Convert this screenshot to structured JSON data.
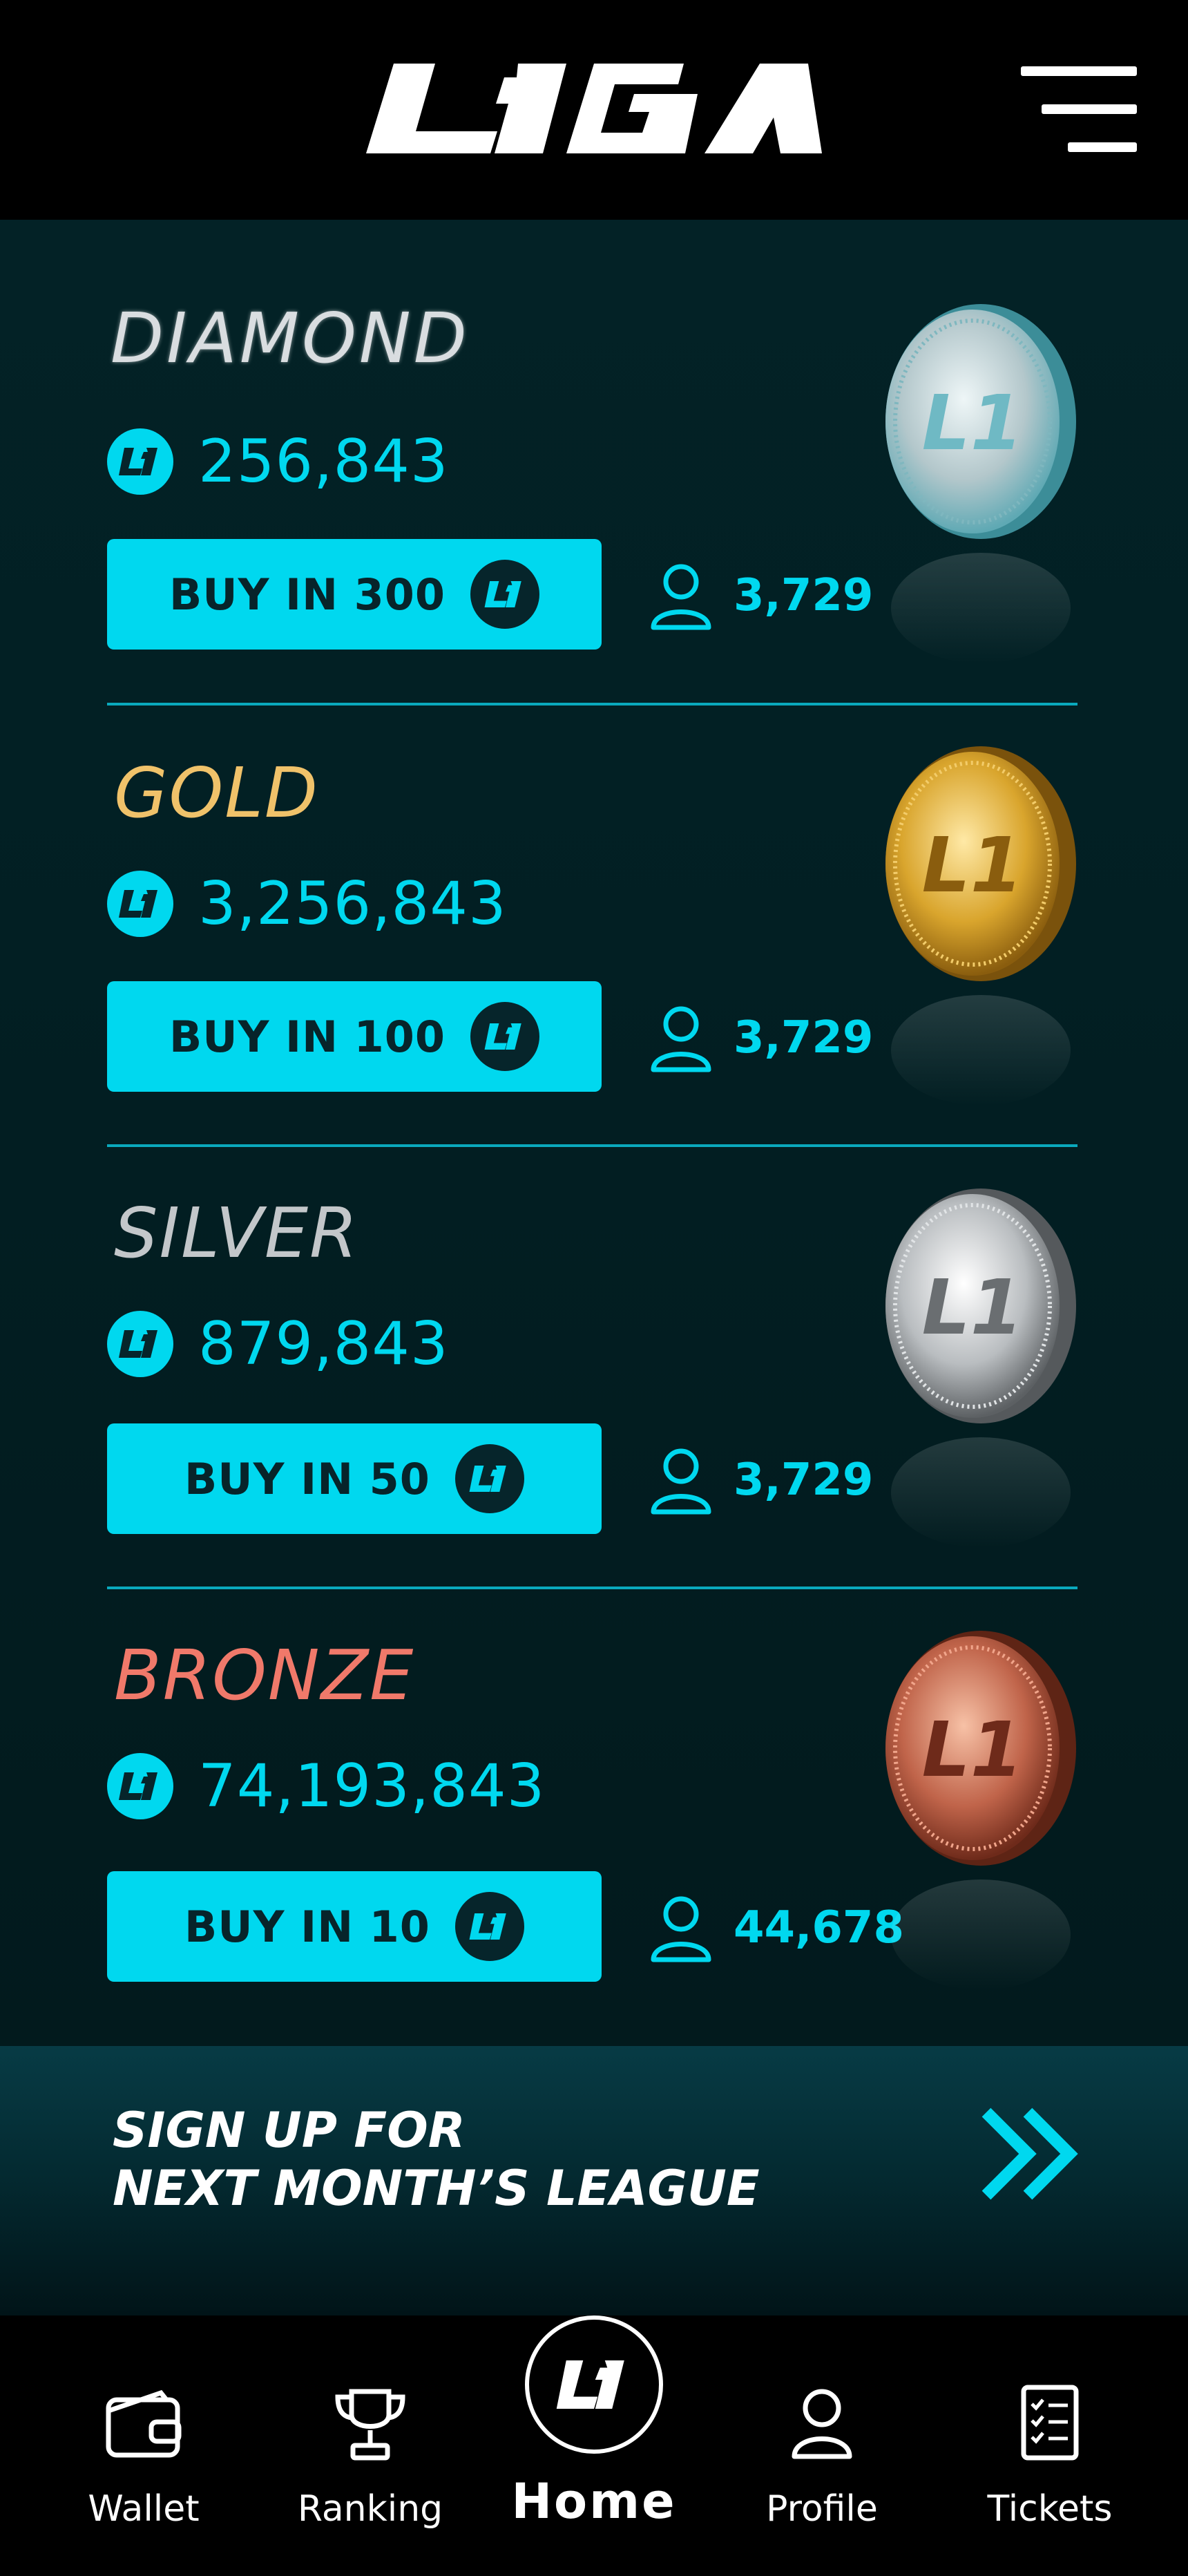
{
  "app": {
    "logo_text": "L1GA",
    "menu_icon": "hamburger-menu-icon"
  },
  "leagues": [
    {
      "name": "DIAMOND",
      "color": "#d9dde0",
      "amount": "256,843",
      "buy_label": "BUY IN 300",
      "players": "3,729",
      "medal_color": "#8fd3dc"
    },
    {
      "name": "GOLD",
      "color": "#f0c26a",
      "amount": "3,256,843",
      "buy_label": "BUY IN 100",
      "players": "3,729",
      "medal_color": "#d9a52d"
    },
    {
      "name": "SILVER",
      "color": "#c3c7ca",
      "amount": "879,843",
      "buy_label": "BUY IN 50",
      "players": "3,729",
      "medal_color": "#bfc3c6"
    },
    {
      "name": "BRONZE",
      "color": "#f0796a",
      "amount": "74,193,843",
      "buy_label": "BUY IN 10",
      "players": "44,678",
      "medal_color": "#c0644a"
    }
  ],
  "signup": {
    "line1": "SIGN UP FOR",
    "line2": "NEXT MONTH’S LEAGUE",
    "arrow_icon": "double-chevron-right-icon"
  },
  "nav": {
    "wallet": "Wallet",
    "ranking": "Ranking",
    "home": "Home",
    "profile": "Profile",
    "tickets": "Tickets"
  },
  "colors": {
    "accent": "#00d8ef",
    "background": "#021f23",
    "button_text": "#07242a"
  }
}
